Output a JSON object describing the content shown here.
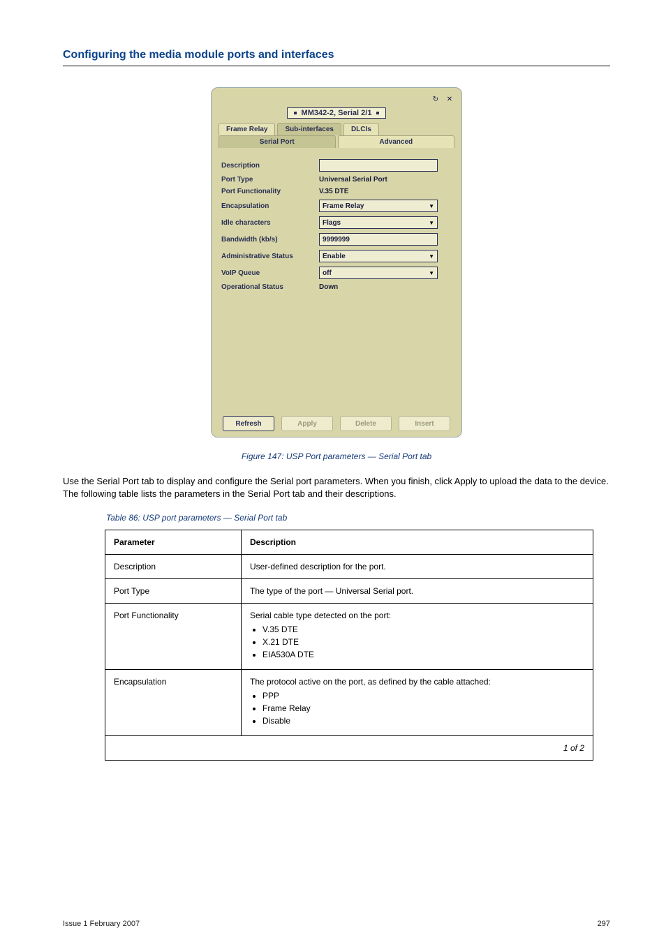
{
  "section_title": "Configuring the media module ports and interfaces",
  "window": {
    "icons": {
      "refresh": "↻",
      "close": "✕"
    },
    "breadcrumb": "MM342-2, Serial 2/1",
    "tabs_row1": [
      {
        "label": "Frame Relay",
        "active": false
      },
      {
        "label": "Sub-interfaces",
        "active": true
      },
      {
        "label": "DLCIs",
        "active": false
      }
    ],
    "tabs_row2": [
      {
        "label": "Serial Port",
        "active": true
      },
      {
        "label": "Advanced",
        "active": false
      }
    ],
    "rows": [
      {
        "label": "Description",
        "type": "input",
        "value": ""
      },
      {
        "label": "Port Type",
        "type": "static",
        "value": "Universal Serial Port"
      },
      {
        "label": "Port Functionality",
        "type": "static",
        "value": "V.35 DTE"
      },
      {
        "label": "Encapsulation",
        "type": "select",
        "value": "Frame Relay"
      },
      {
        "label": "Idle characters",
        "type": "select",
        "value": "Flags"
      },
      {
        "label": "Bandwidth (kb/s)",
        "type": "input",
        "value": "9999999"
      },
      {
        "label": "Administrative Status",
        "type": "select",
        "value": "Enable"
      },
      {
        "label": "VoIP Queue",
        "type": "select",
        "value": "off"
      },
      {
        "label": "Operational Status",
        "type": "static",
        "value": "Down"
      }
    ],
    "buttons": [
      {
        "label": "Refresh",
        "disabled": false
      },
      {
        "label": "Apply",
        "disabled": true
      },
      {
        "label": "Delete",
        "disabled": true
      },
      {
        "label": "Insert",
        "disabled": true
      }
    ]
  },
  "figure_caption": "Figure 147: USP Port parameters — Serial Port tab",
  "body_paragraph": "Use the Serial Port tab to display and configure the Serial port parameters. When you finish, click Apply to upload the data to the device. The following table lists the parameters in the Serial Port tab and their descriptions.",
  "table_caption": "Table 86: USP port parameters — Serial Port tab",
  "table": {
    "headers": [
      "Parameter",
      "Description"
    ],
    "rows": [
      {
        "param": "Description",
        "desc_text": "User-defined description for the port."
      },
      {
        "param": "Port Type",
        "desc_text": "The type of the port — Universal Serial port."
      },
      {
        "param": "Port Functionality",
        "desc_text": "Serial cable type detected on the port:",
        "bullets": [
          "V.35 DTE",
          "X.21 DTE",
          "EIA530A DTE"
        ]
      },
      {
        "param": "Encapsulation",
        "desc_text": "The protocol active on the port, as defined by the cable attached:",
        "bullets": [
          "PPP",
          "Frame Relay",
          "Disable"
        ]
      }
    ],
    "footer_row": "1 of 2"
  },
  "footer": {
    "left": "Issue 1 February 2007",
    "right": "297"
  }
}
